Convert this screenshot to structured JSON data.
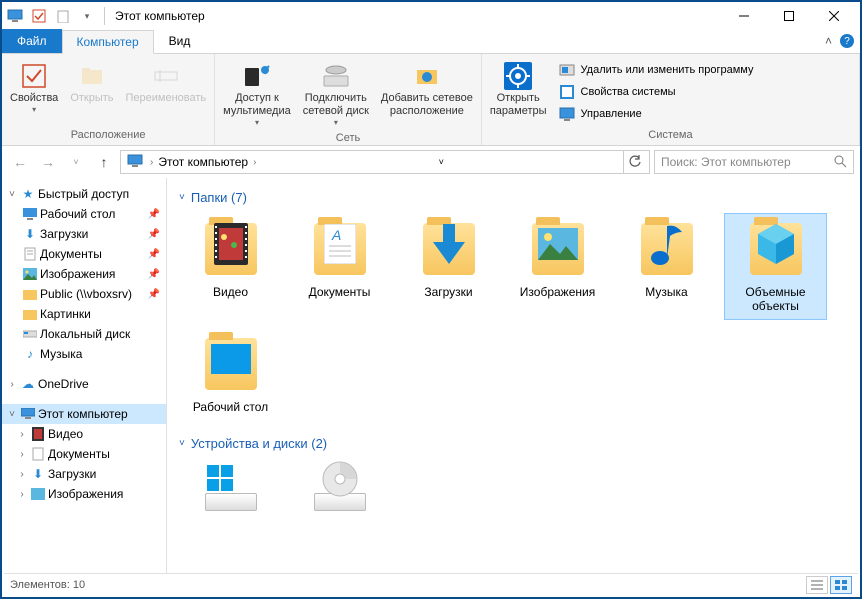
{
  "window": {
    "title": "Этот компьютер"
  },
  "tabs": {
    "file": "Файл",
    "computer": "Компьютер",
    "view": "Вид"
  },
  "ribbon": {
    "location": {
      "label": "Расположение",
      "properties": "Свойства",
      "open": "Открыть",
      "rename": "Переименовать"
    },
    "network": {
      "label": "Сеть",
      "media": "Доступ к\nмультимедиа",
      "mapdrive": "Подключить\nсетевой диск",
      "addloc": "Добавить сетевое\nрасположение"
    },
    "system": {
      "label": "Система",
      "settings": "Открыть\nпараметры",
      "uninstall": "Удалить или изменить программу",
      "sysprops": "Свойства системы",
      "manage": "Управление"
    }
  },
  "nav": {
    "breadcrumb": "Этот компьютер",
    "searchPlaceholder": "Поиск: Этот компьютер"
  },
  "tree": {
    "quick": "Быстрый доступ",
    "desktop": "Рабочий стол",
    "downloads": "Загрузки",
    "documents": "Документы",
    "pictures_q": "Изображения",
    "public": "Public (\\\\vboxsrv)",
    "pics": "Картинки",
    "localdisk": "Локальный диск",
    "music": "Музыка",
    "onedrive": "OneDrive",
    "thispc": "Этот компьютер",
    "videos": "Видео",
    "docs2": "Документы",
    "dl2": "Загрузки",
    "pics2": "Изображения"
  },
  "content": {
    "foldersHeader": "Папки (7)",
    "devicesHeader": "Устройства и диски (2)",
    "folders": {
      "videos": "Видео",
      "documents": "Документы",
      "downloads": "Загрузки",
      "pictures": "Изображения",
      "music": "Музыка",
      "objects3d": "Объемные объекты",
      "desktop": "Рабочий стол"
    }
  },
  "status": {
    "items": "Элементов: 10"
  }
}
